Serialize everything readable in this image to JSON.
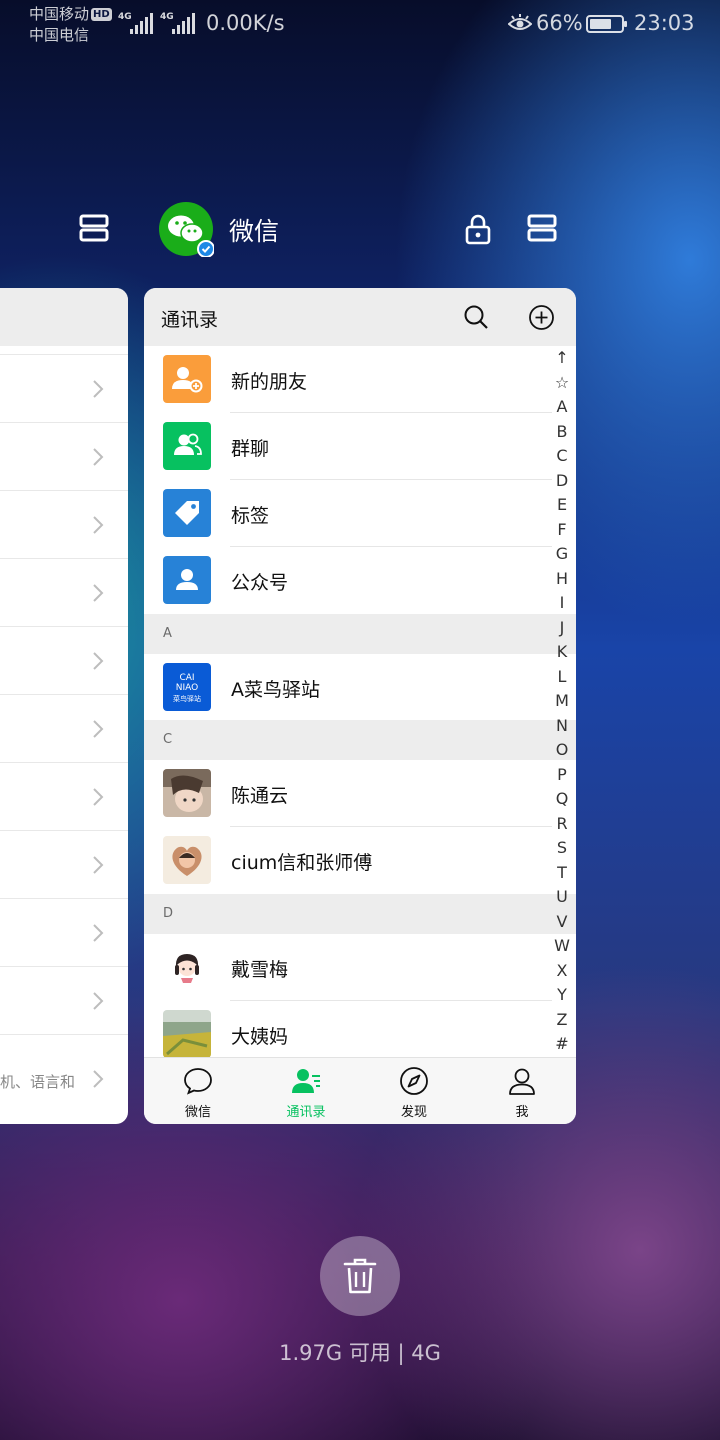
{
  "status_bar": {
    "carrier1": "中国移动",
    "hd": "HD",
    "carrier2": "中国电信",
    "net1": "4G",
    "net2": "4G",
    "speed": "0.00K/s",
    "battery": "66%",
    "time": "23:03"
  },
  "recent": {
    "app_name": "微信",
    "memory": "1.97G 可用 | 4G"
  },
  "left_card": {
    "bottom_text": "机、语言和"
  },
  "wechat": {
    "title": "通讯录",
    "top_items": [
      {
        "label": "新的朋友",
        "color": "#fa9d3b"
      },
      {
        "label": "群聊",
        "color": "#07c160"
      },
      {
        "label": "标签",
        "color": "#2782d7"
      },
      {
        "label": "公众号",
        "color": "#2782d7"
      }
    ],
    "sections": [
      {
        "letter": "A",
        "contacts": [
          "A菜鸟驿站"
        ]
      },
      {
        "letter": "C",
        "contacts": [
          "陈通云",
          "cium信和张师傅"
        ]
      },
      {
        "letter": "D",
        "contacts": [
          "戴雪梅",
          "大姨妈"
        ]
      }
    ],
    "cainiao_logo": {
      "line1": "CAI",
      "line2": "NIAO",
      "line3": "菜鸟驿站"
    },
    "index": [
      "↑",
      "☆",
      "A",
      "B",
      "C",
      "D",
      "E",
      "F",
      "G",
      "H",
      "I",
      "J",
      "K",
      "L",
      "M",
      "N",
      "O",
      "P",
      "Q",
      "R",
      "S",
      "T",
      "U",
      "V",
      "W",
      "X",
      "Y",
      "Z",
      "#"
    ],
    "tabs": [
      {
        "label": "微信"
      },
      {
        "label": "通讯录"
      },
      {
        "label": "发现"
      },
      {
        "label": "我"
      }
    ],
    "accent": "#07c160"
  }
}
